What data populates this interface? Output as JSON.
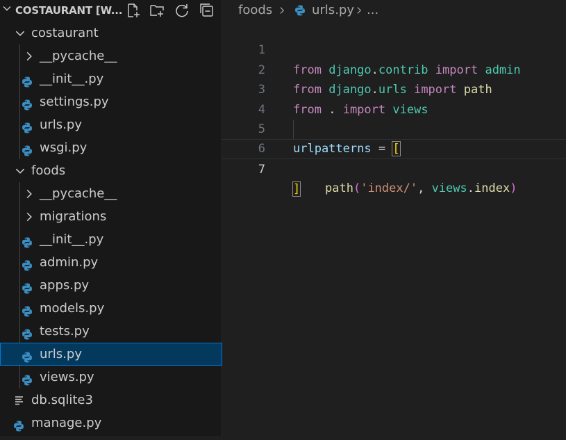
{
  "explorer": {
    "project_title": "COSTAURANT [W...",
    "actions": [
      "new-file-icon",
      "new-folder-icon",
      "refresh-icon",
      "collapse-all-icon"
    ],
    "tree": [
      {
        "label": "costaurant",
        "type": "folder",
        "expanded": true,
        "depth": 0
      },
      {
        "label": "__pycache__",
        "type": "folder",
        "expanded": false,
        "depth": 1
      },
      {
        "label": "__init__.py",
        "type": "python",
        "depth": 1
      },
      {
        "label": "settings.py",
        "type": "python",
        "depth": 1
      },
      {
        "label": "urls.py",
        "type": "python",
        "depth": 1
      },
      {
        "label": "wsgi.py",
        "type": "python",
        "depth": 1
      },
      {
        "label": "foods",
        "type": "folder",
        "expanded": true,
        "depth": 0
      },
      {
        "label": "__pycache__",
        "type": "folder",
        "expanded": false,
        "depth": 1
      },
      {
        "label": "migrations",
        "type": "folder",
        "expanded": false,
        "depth": 1
      },
      {
        "label": "__init__.py",
        "type": "python",
        "depth": 1
      },
      {
        "label": "admin.py",
        "type": "python",
        "depth": 1
      },
      {
        "label": "apps.py",
        "type": "python",
        "depth": 1
      },
      {
        "label": "models.py",
        "type": "python",
        "depth": 1
      },
      {
        "label": "tests.py",
        "type": "python",
        "depth": 1
      },
      {
        "label": "urls.py",
        "type": "python",
        "depth": 1,
        "selected": true
      },
      {
        "label": "views.py",
        "type": "python",
        "depth": 1
      },
      {
        "label": "db.sqlite3",
        "type": "text",
        "depth": 0
      },
      {
        "label": "manage.py",
        "type": "python",
        "depth": 0
      }
    ]
  },
  "breadcrumb": {
    "folder": "foods",
    "file": "urls.py",
    "more": "..."
  },
  "editor": {
    "line_numbers": [
      "1",
      "2",
      "3",
      "4",
      "5",
      "6",
      "7"
    ],
    "current_line": 7,
    "line1": {
      "kw1": "from",
      "mod": "django",
      "dot": ".",
      "mod2": "contrib",
      "kw2": "import",
      "name": "admin"
    },
    "line2": {
      "kw1": "from",
      "mod": "django",
      "dot": ".",
      "mod2": "urls",
      "kw2": "import",
      "name": "path"
    },
    "line3": {
      "kw1": "from",
      "dot": ".",
      "kw2": "import",
      "name": "views"
    },
    "line5": {
      "var": "urlpatterns",
      "eq": " = ",
      "open": "["
    },
    "line6": {
      "fn": "path",
      "lp": "(",
      "str": "'index/'",
      "comma": ", ",
      "obj": "views",
      "dot": ".",
      "attr": "index",
      "rp": ")"
    },
    "line7": {
      "close": "]"
    }
  },
  "colors": {
    "background": "#1f1f1f",
    "sidebar": "#181818",
    "selection": "#04395e",
    "selection_border": "#0078d4",
    "keyword": "#c586c0",
    "module": "#4ec9b0",
    "variable": "#9cdcfe",
    "function": "#dcdcaa",
    "string": "#ce9178",
    "bracket": "#ffd700",
    "python_icon": "#3b8ec2"
  }
}
